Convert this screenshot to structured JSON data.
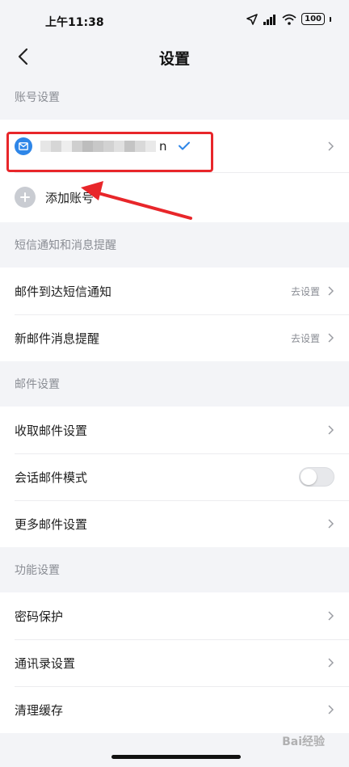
{
  "status": {
    "time": "上午11:38",
    "battery": "100"
  },
  "nav": {
    "title": "设置"
  },
  "sections": {
    "account": "账号设置",
    "sms": "短信通知和消息提醒",
    "mail": "邮件设置",
    "feature": "功能设置"
  },
  "account": {
    "suffix": "n",
    "add_label": "添加账号"
  },
  "sms_items": [
    {
      "label": "邮件到达短信通知",
      "hint": "去设置"
    },
    {
      "label": "新邮件消息提醒",
      "hint": "去设置"
    }
  ],
  "mail_items": [
    {
      "label": "收取邮件设置"
    },
    {
      "label": "会话邮件模式",
      "toggle": false
    },
    {
      "label": "更多邮件设置"
    }
  ],
  "feature_items": [
    {
      "label": "密码保护"
    },
    {
      "label": "通讯录设置"
    },
    {
      "label": "清理缓存"
    }
  ],
  "watermark": "Bai经验",
  "colors": {
    "accent": "#2e86e8",
    "highlight": "#e8262a"
  }
}
